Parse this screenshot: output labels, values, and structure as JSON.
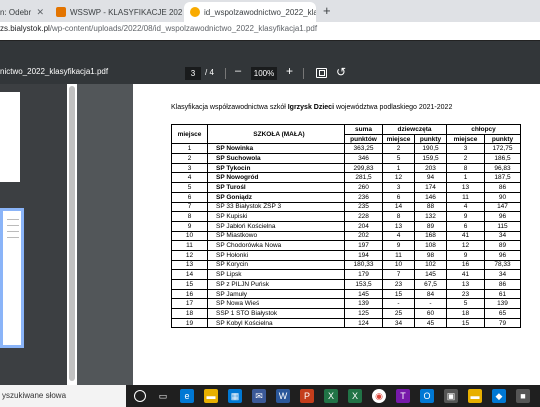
{
  "browser": {
    "tabs": [
      {
        "label": "n: Odebr"
      },
      {
        "label": "WSSWP - KLASYFIKACJE 2021/2"
      },
      {
        "label": "id_wspolzawodnictwo_2022_klas"
      }
    ],
    "url_prefix": "zs.bialystok.pl",
    "url_rest": "/wp-content/uploads/2022/08/id_wspolzawodnictwo_2022_klasyfikacja1.pdf"
  },
  "pdf": {
    "title": "nictwo_2022_klasyfikacja1.pdf",
    "page_current": "3",
    "page_total": "/ 4",
    "zoom_out": "–",
    "zoom": "100%",
    "zoom_in": "+"
  },
  "document": {
    "caption_pre": "Klasyfikacja współzawodnictwa szkół ",
    "caption_bold": "Igrzysk Dzieci",
    "caption_post": " województwa podlaskiego 2021-2022",
    "headers": {
      "miejsce": "miejsce",
      "szkola": "SZKOŁA (MAŁA)",
      "suma_top": "suma",
      "suma_bottom": "punktów",
      "dziewczeta": "dziewczęta",
      "chlopcy": "chłopcy",
      "sub_miejsce": "miejsce",
      "sub_punkty": "punkty",
      "sub_miejsce2": "miejsce",
      "sub_punkty2": "punkty"
    },
    "rows": [
      {
        "m": "1",
        "s": "SP Nowinka",
        "p": "363,25",
        "dm": "2",
        "dp": "190,5",
        "cm": "3",
        "cp": "172,75",
        "bold": true
      },
      {
        "m": "2",
        "s": "SP Suchowola",
        "p": "346",
        "dm": "5",
        "dp": "159,5",
        "cm": "2",
        "cp": "186,5",
        "bold": true
      },
      {
        "m": "3",
        "s": "SP Tykocin",
        "p": "299,83",
        "dm": "1",
        "dp": "203",
        "cm": "8",
        "cp": "96,83",
        "bold": true
      },
      {
        "m": "4",
        "s": "SP Nowogród",
        "p": "281,5",
        "dm": "12",
        "dp": "94",
        "cm": "1",
        "cp": "187,5",
        "bold": true
      },
      {
        "m": "5",
        "s": "SP Turośl",
        "p": "260",
        "dm": "3",
        "dp": "174",
        "cm": "13",
        "cp": "86",
        "bold": true
      },
      {
        "m": "6",
        "s": "SP Goniądz",
        "p": "236",
        "dm": "6",
        "dp": "146",
        "cm": "11",
        "cp": "90",
        "bold": true
      },
      {
        "m": "7",
        "s": "SP 33 Białystok ZSP 3",
        "p": "235",
        "dm": "14",
        "dp": "88",
        "cm": "4",
        "cp": "147",
        "bold": false
      },
      {
        "m": "8",
        "s": "SP Kupiski",
        "p": "228",
        "dm": "8",
        "dp": "132",
        "cm": "9",
        "cp": "96",
        "bold": false
      },
      {
        "m": "9",
        "s": "SP Jabłoń Kościelna",
        "p": "204",
        "dm": "13",
        "dp": "89",
        "cm": "6",
        "cp": "115",
        "bold": false
      },
      {
        "m": "10",
        "s": "SP Miastkowo",
        "p": "202",
        "dm": "4",
        "dp": "168",
        "cm": "41",
        "cp": "34",
        "bold": false
      },
      {
        "m": "11",
        "s": "SP Chodorówka Nowa",
        "p": "197",
        "dm": "9",
        "dp": "108",
        "cm": "12",
        "cp": "89",
        "bold": false
      },
      {
        "m": "12",
        "s": "SP Hołonki",
        "p": "194",
        "dm": "11",
        "dp": "98",
        "cm": "9",
        "cp": "96",
        "bold": false
      },
      {
        "m": "13",
        "s": "SP Korycin",
        "p": "180,33",
        "dm": "10",
        "dp": "102",
        "cm": "16",
        "cp": "78,33",
        "bold": false
      },
      {
        "m": "14",
        "s": "SP Lipsk",
        "p": "179",
        "dm": "7",
        "dp": "145",
        "cm": "41",
        "cp": "34",
        "bold": false
      },
      {
        "m": "15",
        "s": "SP z PILJN Puńsk",
        "p": "153,5",
        "dm": "23",
        "dp": "67,5",
        "cm": "13",
        "cp": "86",
        "bold": false
      },
      {
        "m": "16",
        "s": "SP Jamuły",
        "p": "145",
        "dm": "15",
        "dp": "84",
        "cm": "23",
        "cp": "61",
        "bold": false
      },
      {
        "m": "17",
        "s": "SP Nowa Wieś",
        "p": "139",
        "dm": "-",
        "dp": "-",
        "cm": "5",
        "cp": "139",
        "bold": false
      },
      {
        "m": "18",
        "s": "SSP 1 STO Białystok",
        "p": "125",
        "dm": "25",
        "dp": "60",
        "cm": "18",
        "cp": "65",
        "bold": false
      },
      {
        "m": "19",
        "s": "SP Kobyl Kościelna",
        "p": "124",
        "dm": "34",
        "dp": "45",
        "cm": "15",
        "cp": "79",
        "bold": false
      }
    ]
  },
  "taskbar": {
    "search_placeholder": "yszukiwane słowa"
  }
}
